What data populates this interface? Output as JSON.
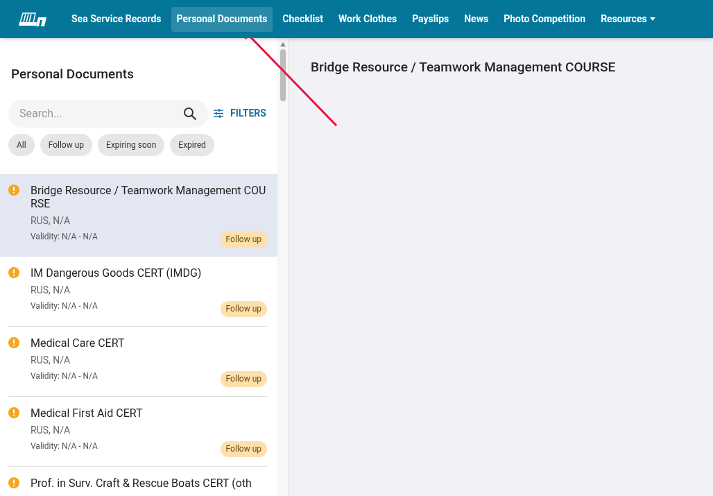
{
  "nav": {
    "items": [
      {
        "label": "Sea Service Records",
        "selected": false,
        "kind": "link"
      },
      {
        "label": "Personal Documents",
        "selected": true,
        "kind": "link"
      },
      {
        "label": "Checklist",
        "selected": false,
        "kind": "link"
      },
      {
        "label": "Work Clothes",
        "selected": false,
        "kind": "link"
      },
      {
        "label": "Payslips",
        "selected": false,
        "kind": "link"
      },
      {
        "label": "News",
        "selected": false,
        "kind": "link"
      },
      {
        "label": "Photo Competition",
        "selected": false,
        "kind": "link"
      },
      {
        "label": "Resources",
        "selected": false,
        "kind": "dropdown"
      }
    ]
  },
  "sidebar": {
    "title": "Personal Documents",
    "search": {
      "placeholder": "Search..."
    },
    "filters_button": "FILTERS",
    "chips": [
      "All",
      "Follow up",
      "Expiring soon",
      "Expired"
    ],
    "documents": [
      {
        "title": "Bridge Resource / Teamwork Management COURSE",
        "subtitle": "RUS, N/A",
        "validity": "Validity: N/A - N/A",
        "status": "Follow up",
        "selected": true
      },
      {
        "title": "IM Dangerous Goods CERT (IMDG)",
        "subtitle": "RUS, N/A",
        "validity": "Validity: N/A - N/A",
        "status": "Follow up",
        "selected": false
      },
      {
        "title": "Medical Care CERT",
        "subtitle": "RUS, N/A",
        "validity": "Validity: N/A - N/A",
        "status": "Follow up",
        "selected": false
      },
      {
        "title": "Medical First Aid CERT",
        "subtitle": "RUS, N/A",
        "validity": "Validity: N/A - N/A",
        "status": "Follow up",
        "selected": false
      },
      {
        "title": "Prof. in Surv. Craft & Rescue Boats CERT (oth",
        "selected": false
      }
    ]
  },
  "detail": {
    "title": "Bridge Resource / Teamwork Management COURSE"
  }
}
